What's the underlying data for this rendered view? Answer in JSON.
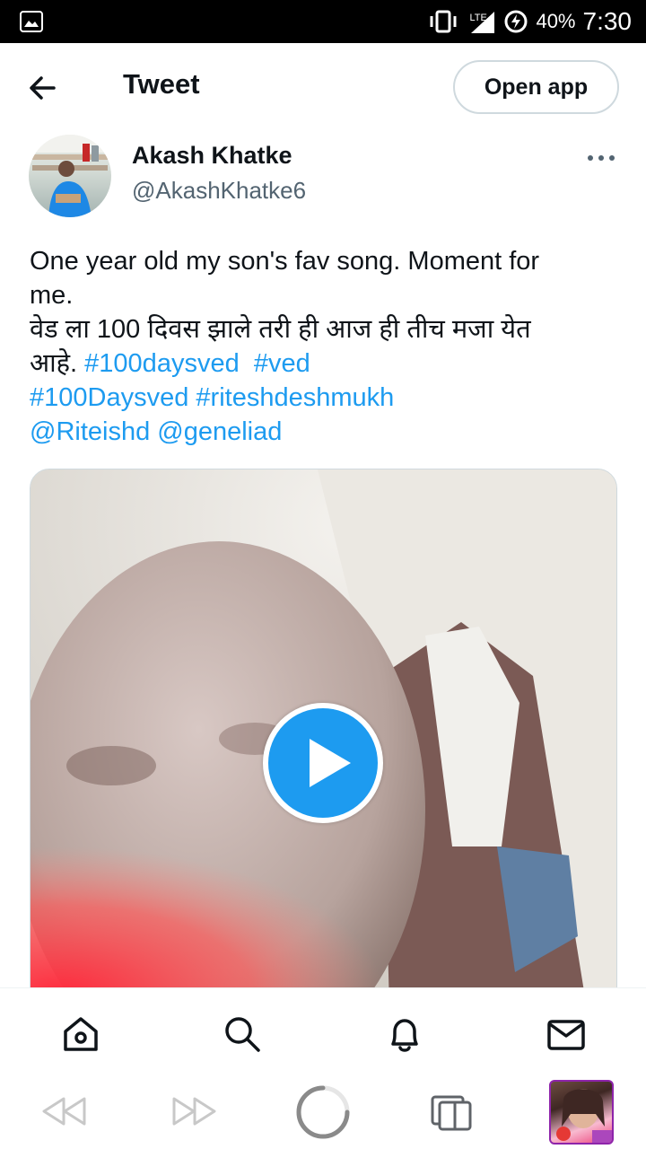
{
  "status_bar": {
    "network": "LTE",
    "battery": "40%",
    "time": "7:30"
  },
  "header": {
    "title": "Tweet",
    "open_app_label": "Open app"
  },
  "author": {
    "name": "Akash Khatke",
    "handle": "@AkashKhatke6"
  },
  "tweet": {
    "line1": "One year old my son's fav song.  Moment for",
    "line2": "me.",
    "line3": "वेड ला 100 दिवस झाले तरी ही आज ही तीच मजा येत",
    "line4_text": "आहे.",
    "hashtag1": "#100daysved",
    "hashtag2": "#ved",
    "hashtag3": "#100Daysved",
    "hashtag4": "#riteshdeshmukh",
    "mention1": "@Riteishd",
    "mention2": "@geneliad"
  },
  "colors": {
    "accent": "#1d9bf0",
    "text": "#0f1419",
    "secondary": "#536471"
  },
  "icons": {
    "header": [
      "back-arrow-icon",
      "more-icon"
    ],
    "bottom_nav": [
      "home-icon",
      "search-icon",
      "notifications-icon",
      "messages-icon"
    ],
    "browser": [
      "rewind-icon",
      "fast-forward-icon",
      "loading-icon",
      "tabs-icon"
    ]
  }
}
